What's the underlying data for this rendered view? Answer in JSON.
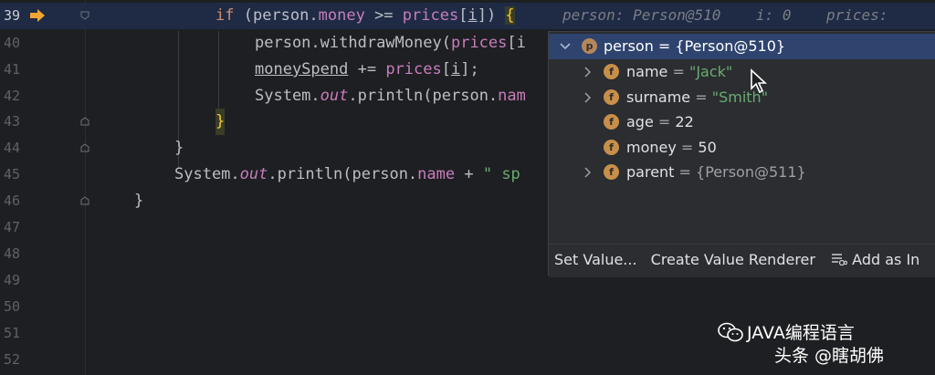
{
  "line_numbers": [
    "39",
    "40",
    "41",
    "42",
    "43",
    "44",
    "45",
    "46",
    "47",
    "48",
    "49",
    "50",
    "51",
    "52"
  ],
  "code": {
    "l39": {
      "kw_if": "if",
      "p1": " (",
      "person": "person",
      ".1": ".",
      "money": "money",
      "op": " >= ",
      "prices": "prices",
      "br": "[",
      "i": "i",
      "br2": "]) ",
      "brace": "{"
    },
    "l40": {
      "t1": "person.",
      "m1": "withdrawMoney",
      "t2": "(",
      "prices": "prices",
      "t3": "[i"
    },
    "l41": {
      "var": "moneySpend",
      "t1": " += ",
      "prices": "prices",
      "t2": "[",
      "i": "i",
      "t3": "];"
    },
    "l42": {
      "t1": "System.",
      "out": "out",
      "t2": ".",
      "m1": "println",
      "t3": "(person.",
      "nam": "nam"
    },
    "l43": {
      "brace": "}"
    },
    "l44": {
      "brace": "}"
    },
    "l45": {
      "t1": "System.",
      "out": "out",
      "t2": ".",
      "m1": "println",
      "t3": "(person.",
      "name": "name",
      "t4": " + ",
      "str": "\" sp"
    },
    "l46": {
      "brace": "}"
    }
  },
  "inline_hint": {
    "person": "person: Person@510",
    "i": "i: 0",
    "prices": "prices:"
  },
  "popup": {
    "root": {
      "badge": "p",
      "label": "person = {Person@510}"
    },
    "fields": [
      {
        "badge": "f",
        "name": "name",
        "eq": " = ",
        "value": "\"Jack\"",
        "expandable": true
      },
      {
        "badge": "f",
        "name": "surname",
        "eq": " = ",
        "value": "\"Smith\"",
        "expandable": true
      },
      {
        "badge": "f",
        "name": "age",
        "eq": " = ",
        "value": "22",
        "expandable": false
      },
      {
        "badge": "f",
        "name": "money",
        "eq": " = ",
        "value": "50",
        "expandable": false
      },
      {
        "badge": "f",
        "name": "parent",
        "eq": " = ",
        "value": "{Person@511}",
        "expandable": true
      }
    ],
    "toolbar": {
      "set_value": "Set Value...",
      "create_renderer": "Create Value Renderer",
      "add_as": "Add as In"
    }
  },
  "watermark": {
    "account": "JAVA编程语言",
    "platform": "头条 @瞎胡佛"
  },
  "colors": {
    "accent": "#2e436e",
    "current_line": "#1f2b45",
    "badge": "#c78f4a",
    "string": "#6aab73",
    "keyword": "#cf8e6d",
    "field": "#c77dbb"
  }
}
